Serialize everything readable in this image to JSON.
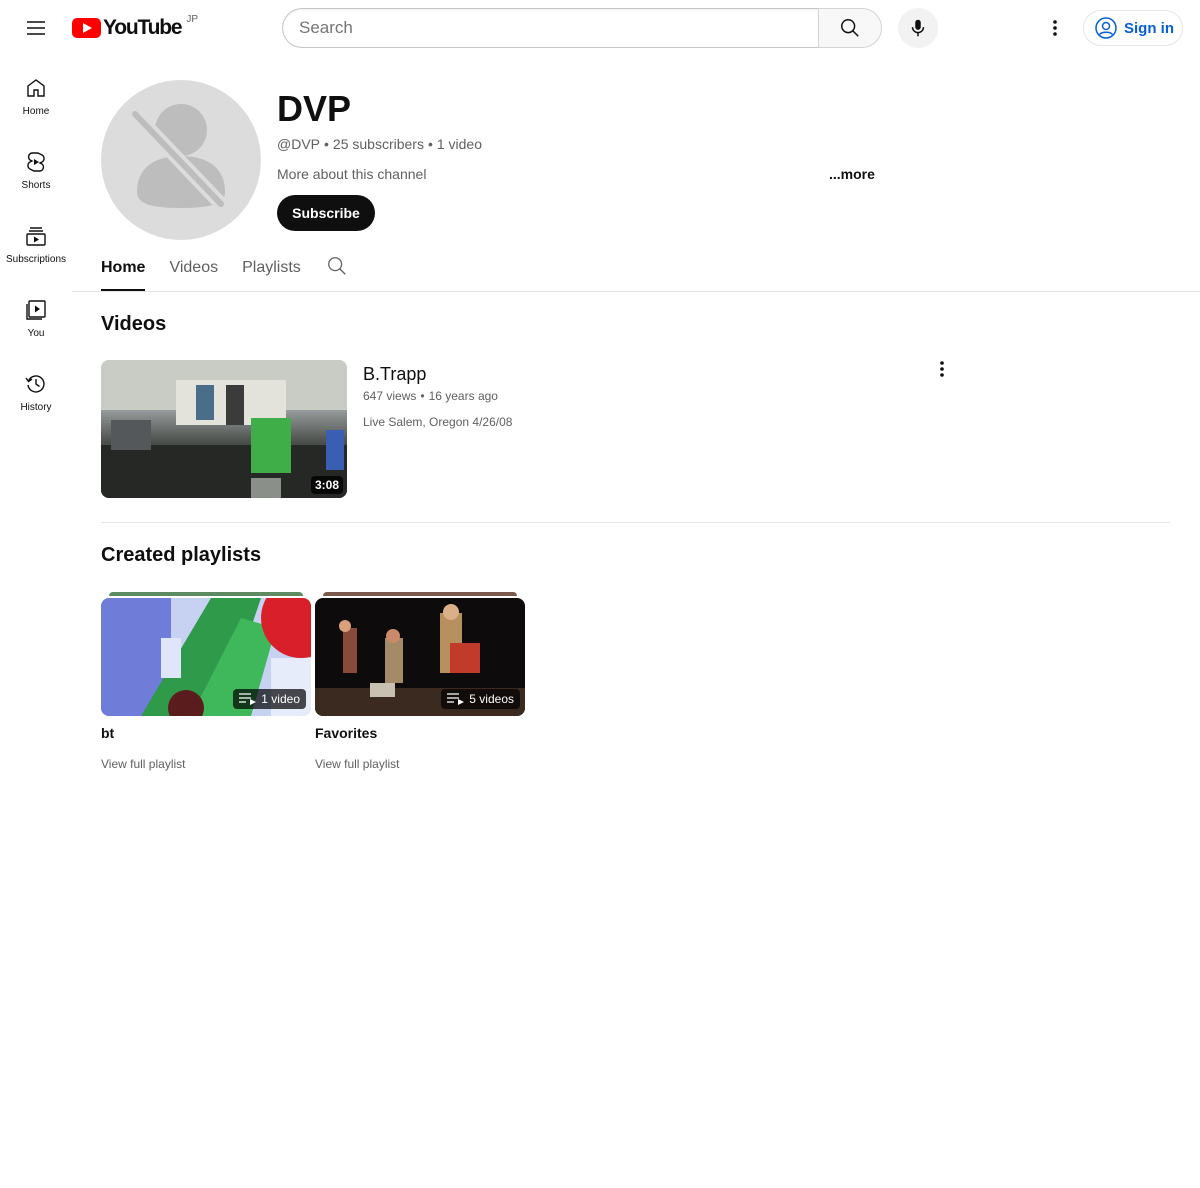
{
  "header": {
    "logo_text": "YouTube",
    "country_code": "JP",
    "search_placeholder": "Search",
    "signin_label": "Sign in",
    "brand_red": "#ff0000",
    "link_blue": "#065fd4"
  },
  "sidebar": {
    "items": [
      {
        "label": "Home",
        "icon": "home-icon"
      },
      {
        "label": "Shorts",
        "icon": "shorts-icon"
      },
      {
        "label": "Subscriptions",
        "icon": "subscriptions-icon"
      },
      {
        "label": "You",
        "icon": "you-icon"
      },
      {
        "label": "History",
        "icon": "history-icon"
      }
    ]
  },
  "channel": {
    "name": "DVP",
    "handle": "@DVP",
    "sep1": "•",
    "subscribers": "25 subscribers",
    "sep2": "•",
    "video_count": "1 video",
    "about": "More about this channel",
    "more": "...more",
    "subscribe_label": "Subscribe"
  },
  "tabs": {
    "items": [
      "Home",
      "Videos",
      "Playlists"
    ],
    "active": "Home"
  },
  "videos_section": {
    "title": "Videos",
    "video": {
      "title": "B.Trapp",
      "views": "647 views",
      "sep": "•",
      "age": "16 years ago",
      "description": "Live Salem, Oregon 4/26/08",
      "duration": "3:08"
    }
  },
  "playlists_section": {
    "title": "Created playlists",
    "playlists": [
      {
        "title": "bt",
        "count": "1 video",
        "link": "View full playlist"
      },
      {
        "title": "Favorites",
        "count": "5 videos",
        "link": "View full playlist"
      }
    ]
  }
}
